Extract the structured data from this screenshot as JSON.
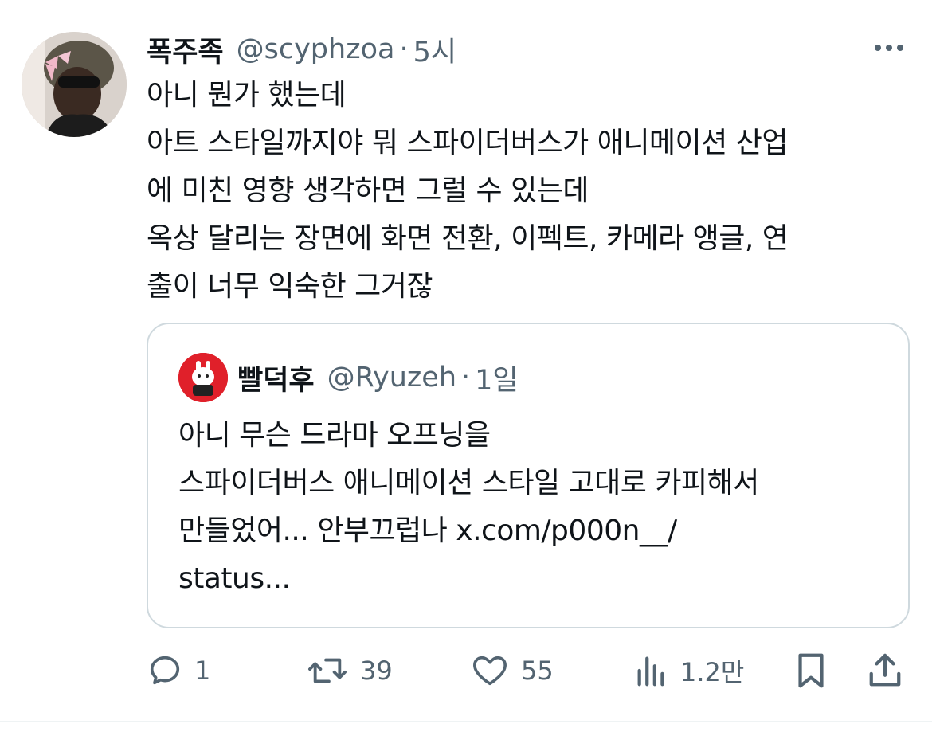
{
  "tweet": {
    "display_name": "폭주족",
    "handle": "@scyphzoa",
    "separator": "·",
    "time": "5시",
    "text": "아니 뭔가 했는데\n아트 스타일까지야 뭐 스파이더버스가 애니메이션 산업\n에 미친 영향 생각하면 그럴 수 있는데\n옥상 달리는 장면에 화면 전환, 이펙트, 카메라 앵글, 연\n출이 너무 익숙한 그거잖"
  },
  "quoted_tweet": {
    "display_name": "빨덕후",
    "handle": "@Ryuzeh",
    "separator": "·",
    "time": "1일",
    "text": "아니 무슨 드라마 오프닝을\n스파이더버스 애니메이션 스타일 고대로 카피해서\n만들었어... 안부끄럽나 x.com/p000n__/\nstatus..."
  },
  "actions": {
    "replies": "1",
    "retweets": "39",
    "likes": "55",
    "views": "1.2만"
  },
  "icons": {
    "more": "more-horizontal-icon",
    "reply": "reply-icon",
    "retweet": "retweet-icon",
    "like": "heart-icon",
    "views": "views-chart-icon",
    "bookmark": "bookmark-icon",
    "share": "share-icon"
  },
  "colors": {
    "text": "#0f1419",
    "secondary": "#536471",
    "border": "#cfd9de",
    "quote_avatar_bg": "#e0202a"
  }
}
